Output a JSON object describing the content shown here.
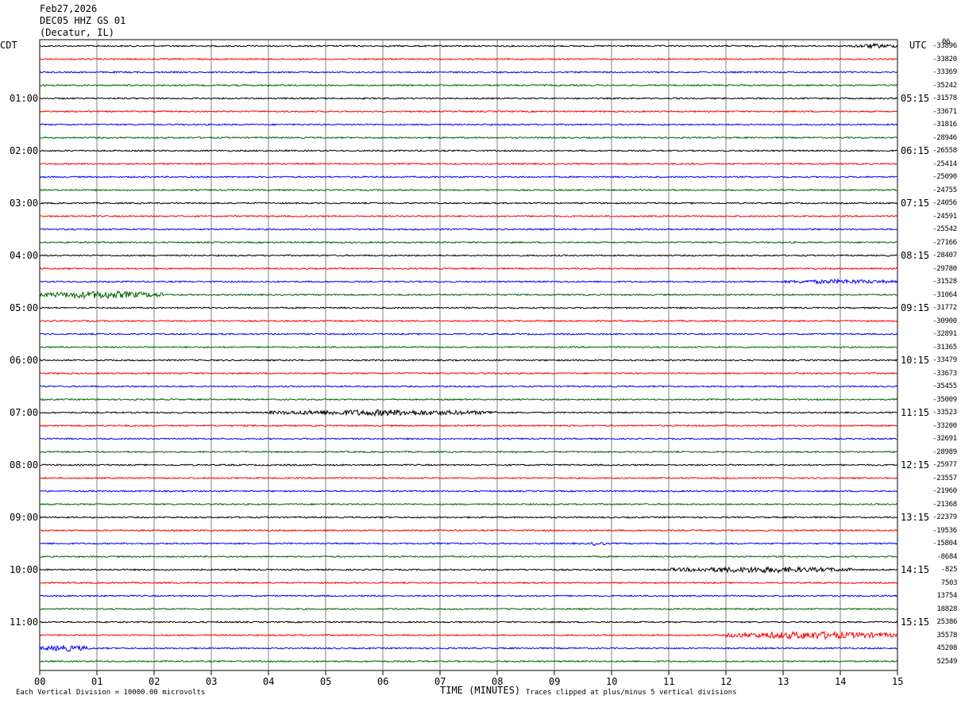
{
  "header": {
    "date": "Feb27,2026",
    "station": "DEC05 HHZ GS 01",
    "location": "(Decatur, IL)"
  },
  "left_tz": "CDT",
  "right_tz": "UTC",
  "top_right_label": "06",
  "footer": {
    "scale": "Each Vertical Division = 10000.00 microvolts",
    "xaxis_title": "TIME (MINUTES)",
    "clip": "Traces clipped at plus/minus 5 vertical divisions"
  },
  "colors": {
    "cycle": [
      "#000000",
      "#ff0000",
      "#0000ff",
      "#006400"
    ],
    "grid": "#808080"
  },
  "chart_data": {
    "type": "line",
    "title": "DEC05 HHZ GS 01",
    "xlabel": "TIME (MINUTES)",
    "xlim": [
      0,
      15
    ],
    "x_ticks": [
      "00",
      "01",
      "02",
      "03",
      "04",
      "05",
      "06",
      "07",
      "08",
      "09",
      "10",
      "11",
      "12",
      "13",
      "14",
      "15"
    ],
    "trace_count": 48,
    "left_hour_labels": [
      "01:00",
      "02:00",
      "03:00",
      "04:00",
      "05:00",
      "06:00",
      "07:00",
      "08:00",
      "09:00",
      "10:00",
      "11:00"
    ],
    "right_hour_labels": [
      "05:15",
      "06:15",
      "07:15",
      "08:15",
      "09:15",
      "10:15",
      "11:15",
      "12:15",
      "13:15",
      "14:15",
      "15:15"
    ],
    "right_trace_values": [
      "-33896",
      "-33820",
      "-33369",
      "-35242",
      "-31578",
      "-33671",
      "-31816",
      "-28946",
      "-26558",
      "-25414",
      "-25090",
      "-24755",
      "-24056",
      "-24591",
      "-25542",
      "-27166",
      "-28407",
      "-29780",
      "-31528",
      "-31064",
      "-31772",
      "-30900",
      "-32891",
      "-31365",
      "-33479",
      "-33673",
      "-35455",
      "-35009",
      "-33523",
      "-33200",
      "-32691",
      "-28989",
      "-25977",
      "-23557",
      "-21960",
      "-21368",
      "-22379",
      "-19536",
      "-15804",
      "-8684",
      "-825",
      "7503",
      "13754",
      "18828",
      "25386",
      "35578",
      "45208",
      "52549"
    ],
    "notes": "Helicorder: each row = 15 minutes of seismic record; colors cycle black, red, blue, green.",
    "events": [
      {
        "trace": 0,
        "x_min_start": 14.2,
        "x_min_end": 15.0,
        "amplitude": 3
      },
      {
        "trace": 18,
        "x_min_start": 13.0,
        "x_min_end": 15.0,
        "amplitude": 3
      },
      {
        "trace": 19,
        "x_min_start": 0.0,
        "x_min_end": 2.2,
        "amplitude": 5
      },
      {
        "trace": 28,
        "x_min_start": 4.0,
        "x_min_end": 8.0,
        "amplitude": 4
      },
      {
        "trace": 38,
        "x_min_start": 9.6,
        "x_min_end": 9.9,
        "amplitude": 3
      },
      {
        "trace": 40,
        "x_min_start": 11.0,
        "x_min_end": 14.2,
        "amplitude": 4
      },
      {
        "trace": 45,
        "x_min_start": 12.0,
        "x_min_end": 15.0,
        "amplitude": 5
      },
      {
        "trace": 46,
        "x_min_start": 0.0,
        "x_min_end": 0.9,
        "amplitude": 4
      }
    ]
  }
}
